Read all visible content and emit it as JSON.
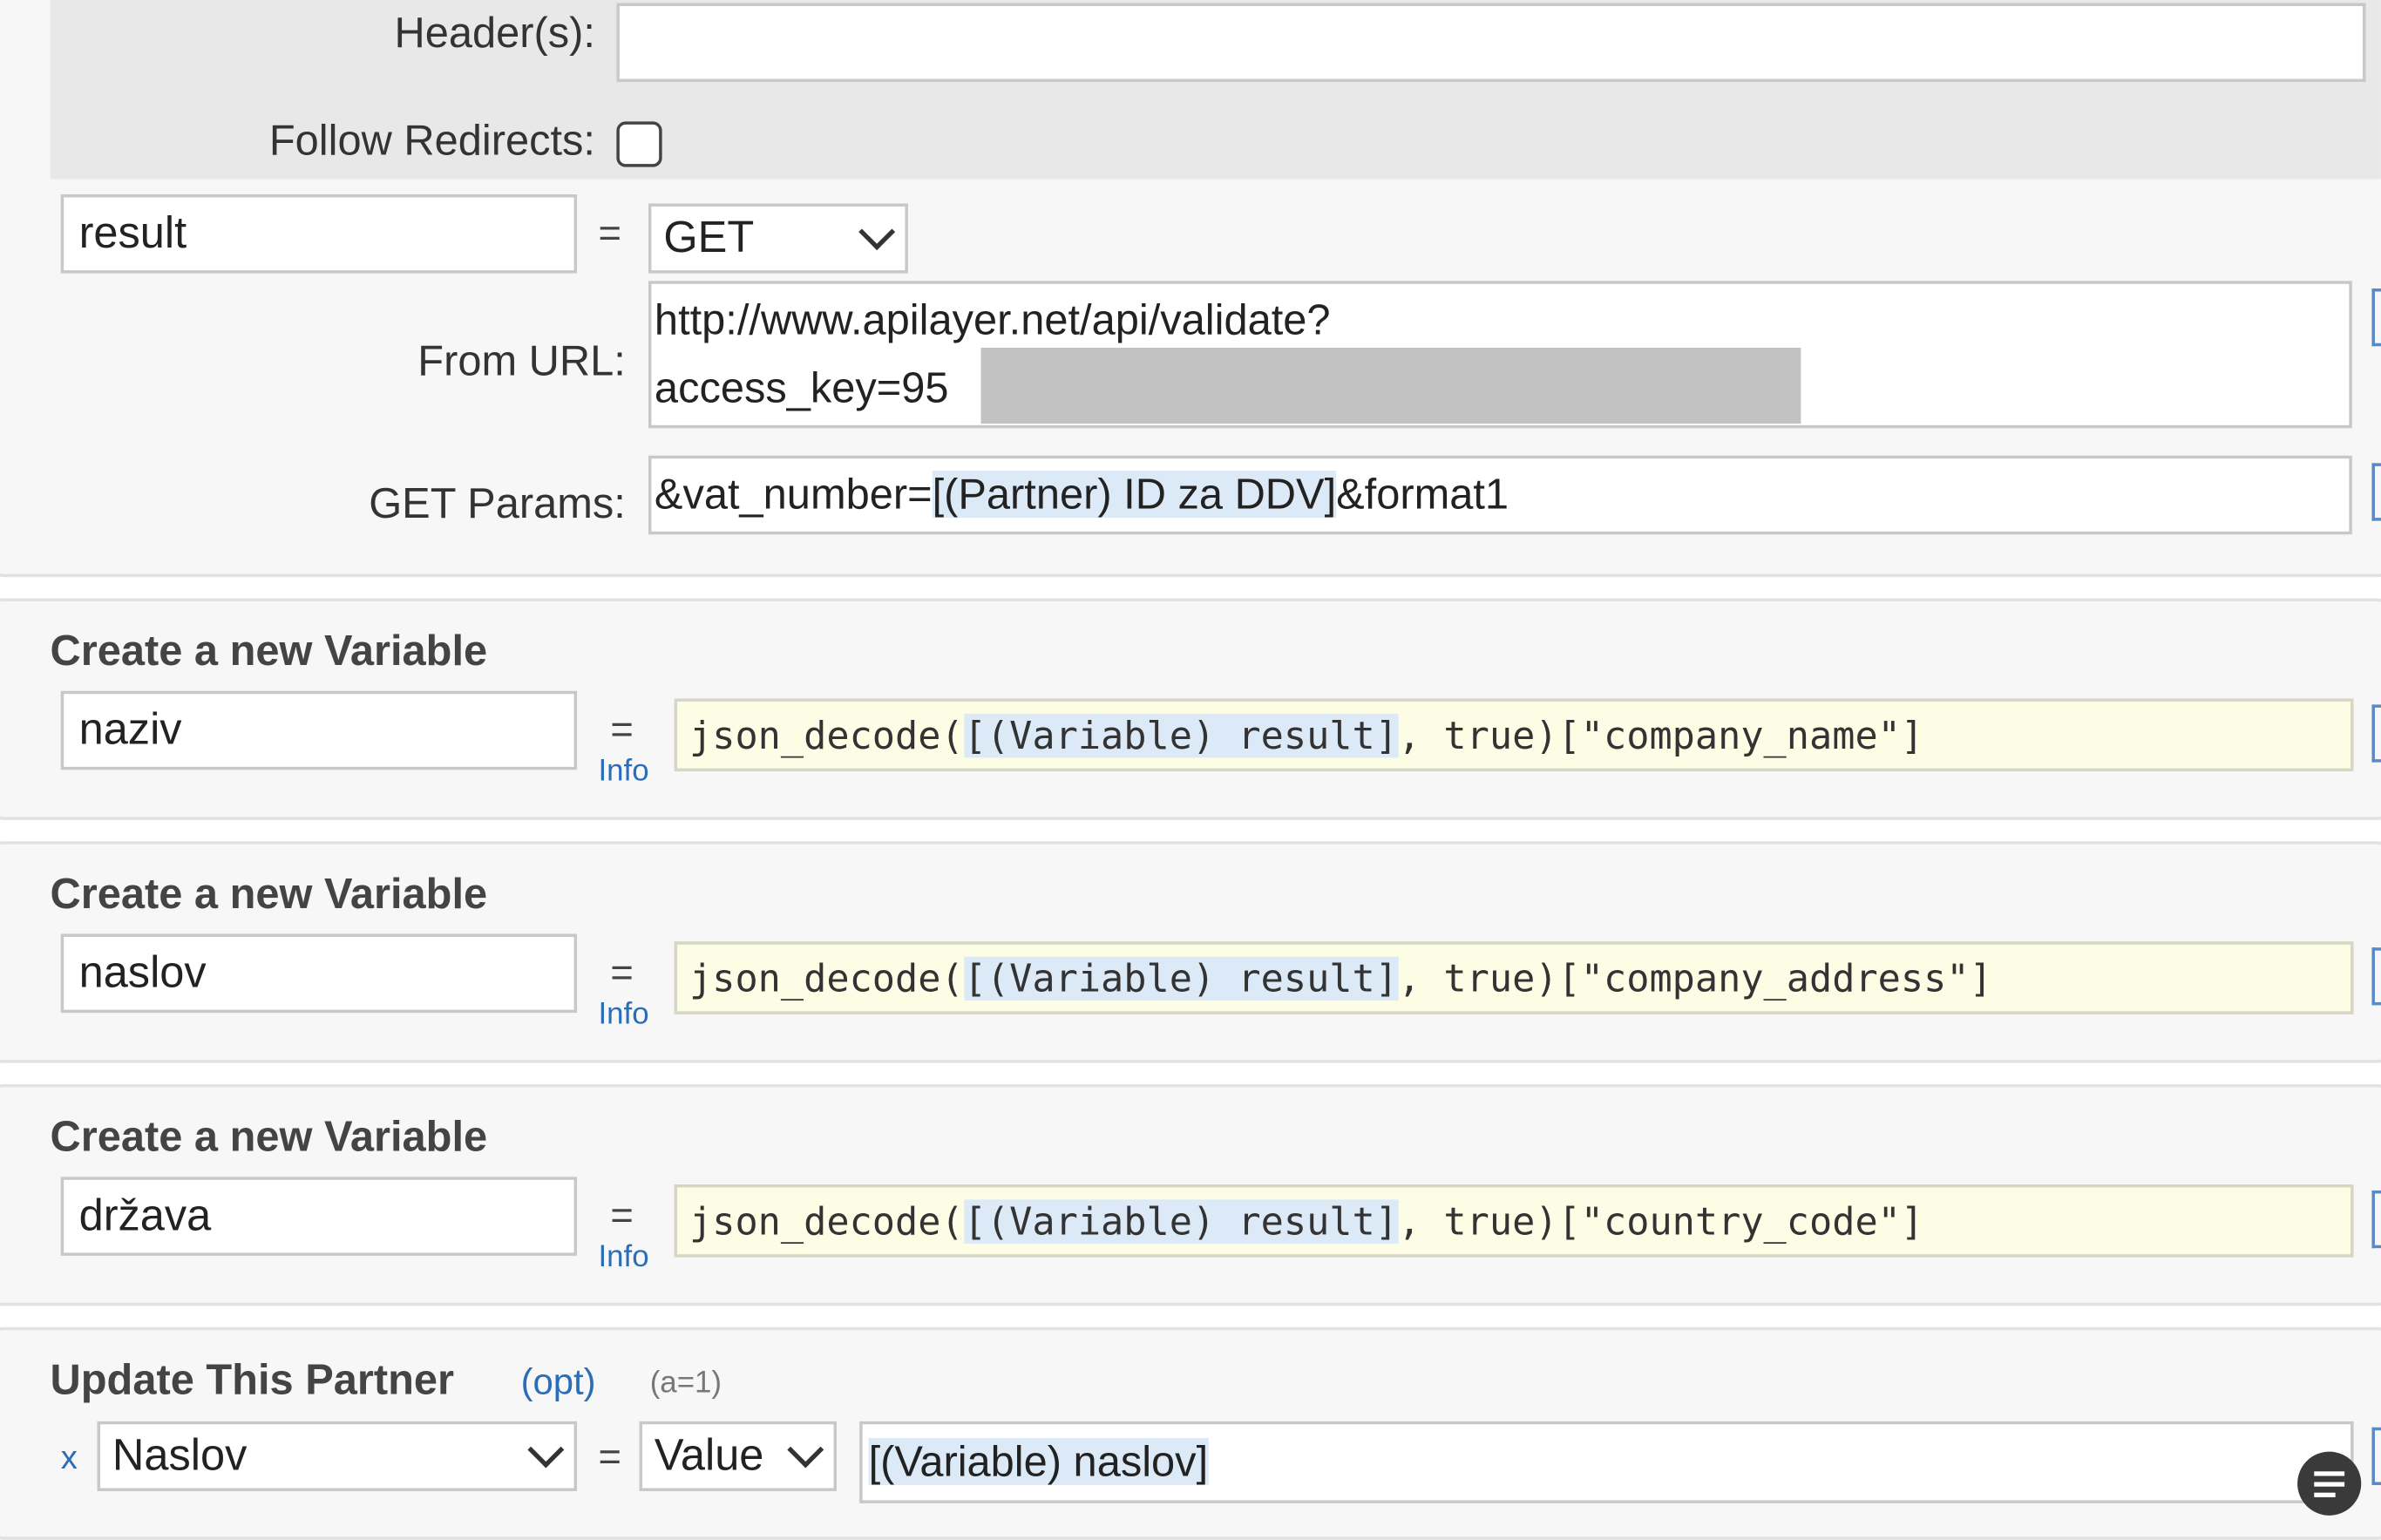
{
  "http_request": {
    "headers_label": "Header(s):",
    "headers_value": "",
    "follow_redirects_label": "Follow Redirects:",
    "follow_redirects_checked": false,
    "result_var": "result",
    "equals": "=",
    "method": "GET",
    "from_url_label": "From URL:",
    "url_line1": "http://www.apilayer.net/api/validate?",
    "url_line2": "access_key=95",
    "get_params_label": "GET Params:",
    "get_params_prefix": "&vat_number=",
    "get_params_token": "[(Partner) ID za DDV]",
    "get_params_suffix": "&format1"
  },
  "variables": [
    {
      "title": "Create a new Variable",
      "name": "naziv",
      "equals": "=",
      "info": "Info",
      "code_prefix": "json_decode(",
      "code_token": "[(Variable) result]",
      "code_suffix": ", true)[\"company_name\"]"
    },
    {
      "title": "Create a new Variable",
      "name": "naslov",
      "equals": "=",
      "info": "Info",
      "code_prefix": "json_decode(",
      "code_token": "[(Variable) result]",
      "code_suffix": ", true)[\"company_address\"]"
    },
    {
      "title": "Create a new Variable",
      "name": "država",
      "equals": "=",
      "info": "Info",
      "code_prefix": "json_decode(",
      "code_token": "[(Variable) result]",
      "code_suffix": ", true)[\"country_code\"]"
    }
  ],
  "update_partner": {
    "title": "Update This Partner",
    "opt": "(opt)",
    "count": "(a=1)",
    "remove": "x",
    "field": "Naslov",
    "equals": "=",
    "mode": "Value",
    "value": "[(Variable) naslov]"
  },
  "icons": {
    "chat": "chat-bubble-icon"
  },
  "colors": {
    "link_blue": "#2a6db8",
    "token_highlight": "#dce9f7",
    "code_bg": "#fdfde6"
  }
}
